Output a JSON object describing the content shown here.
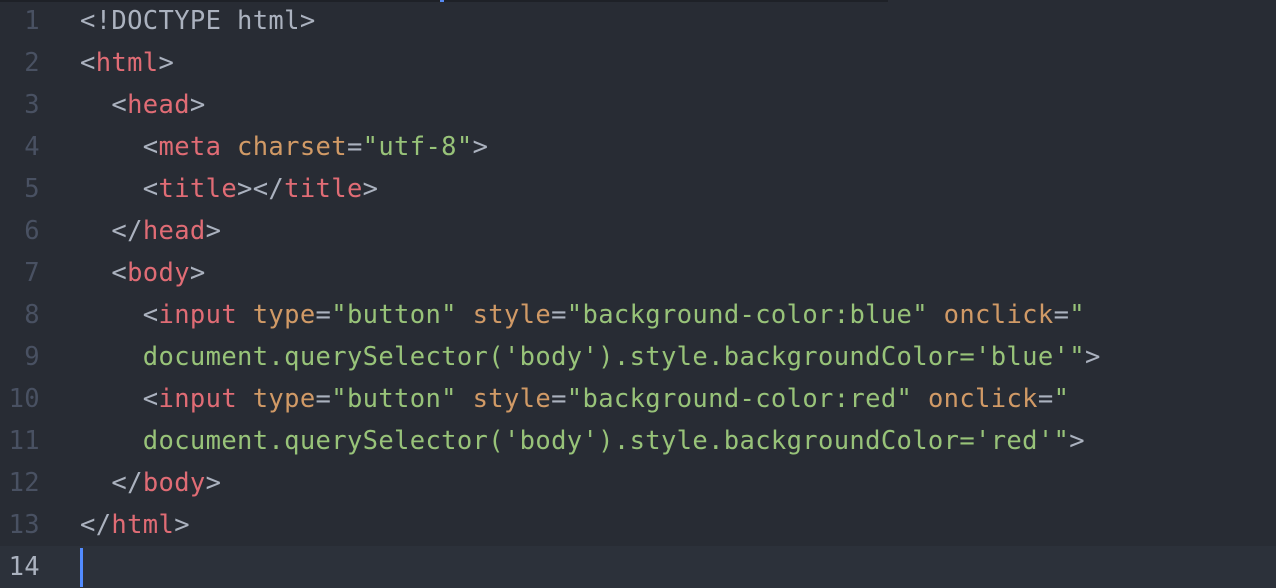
{
  "editor": {
    "lines": [
      {
        "number": "1",
        "tokens": [
          {
            "t": "doctype",
            "v": "<!DOCTYPE html>"
          }
        ]
      },
      {
        "number": "2",
        "tokens": [
          {
            "t": "punct",
            "v": "<"
          },
          {
            "t": "tag",
            "v": "html"
          },
          {
            "t": "punct",
            "v": ">"
          }
        ]
      },
      {
        "number": "3",
        "tokens": [
          {
            "t": "punct",
            "v": "  <"
          },
          {
            "t": "tag",
            "v": "head"
          },
          {
            "t": "punct",
            "v": ">"
          }
        ]
      },
      {
        "number": "4",
        "tokens": [
          {
            "t": "punct",
            "v": "    <"
          },
          {
            "t": "tag",
            "v": "meta"
          },
          {
            "t": "punct",
            "v": " "
          },
          {
            "t": "attr",
            "v": "charset"
          },
          {
            "t": "punct",
            "v": "="
          },
          {
            "t": "str",
            "v": "\"utf-8\""
          },
          {
            "t": "punct",
            "v": ">"
          }
        ]
      },
      {
        "number": "5",
        "tokens": [
          {
            "t": "punct",
            "v": "    <"
          },
          {
            "t": "tag",
            "v": "title"
          },
          {
            "t": "punct",
            "v": "></"
          },
          {
            "t": "tag",
            "v": "title"
          },
          {
            "t": "punct",
            "v": ">"
          }
        ]
      },
      {
        "number": "6",
        "tokens": [
          {
            "t": "punct",
            "v": "  </"
          },
          {
            "t": "tag",
            "v": "head"
          },
          {
            "t": "punct",
            "v": ">"
          }
        ]
      },
      {
        "number": "7",
        "tokens": [
          {
            "t": "punct",
            "v": "  <"
          },
          {
            "t": "tag",
            "v": "body"
          },
          {
            "t": "punct",
            "v": ">"
          }
        ]
      },
      {
        "number": "8",
        "tokens": [
          {
            "t": "punct",
            "v": "    <"
          },
          {
            "t": "tag",
            "v": "input"
          },
          {
            "t": "punct",
            "v": " "
          },
          {
            "t": "attr",
            "v": "type"
          },
          {
            "t": "punct",
            "v": "="
          },
          {
            "t": "str",
            "v": "\"button\""
          },
          {
            "t": "punct",
            "v": " "
          },
          {
            "t": "attr",
            "v": "style"
          },
          {
            "t": "punct",
            "v": "="
          },
          {
            "t": "str",
            "v": "\"background-color:blue\""
          },
          {
            "t": "punct",
            "v": " "
          },
          {
            "t": "attr",
            "v": "onclick"
          },
          {
            "t": "punct",
            "v": "="
          },
          {
            "t": "str",
            "v": "\""
          }
        ]
      },
      {
        "number": "9",
        "tokens": [
          {
            "t": "str",
            "v": "    document.querySelector('body').style.backgroundColor='blue'\""
          },
          {
            "t": "punct",
            "v": ">"
          }
        ]
      },
      {
        "number": "10",
        "tokens": [
          {
            "t": "punct",
            "v": "    <"
          },
          {
            "t": "tag",
            "v": "input"
          },
          {
            "t": "punct",
            "v": " "
          },
          {
            "t": "attr",
            "v": "type"
          },
          {
            "t": "punct",
            "v": "="
          },
          {
            "t": "str",
            "v": "\"button\""
          },
          {
            "t": "punct",
            "v": " "
          },
          {
            "t": "attr",
            "v": "style"
          },
          {
            "t": "punct",
            "v": "="
          },
          {
            "t": "str",
            "v": "\"background-color:red\""
          },
          {
            "t": "punct",
            "v": " "
          },
          {
            "t": "attr",
            "v": "onclick"
          },
          {
            "t": "punct",
            "v": "="
          },
          {
            "t": "str",
            "v": "\""
          }
        ]
      },
      {
        "number": "11",
        "tokens": [
          {
            "t": "str",
            "v": "    document.querySelector('body').style.backgroundColor='red'\""
          },
          {
            "t": "punct",
            "v": ">"
          }
        ]
      },
      {
        "number": "12",
        "tokens": [
          {
            "t": "punct",
            "v": "  </"
          },
          {
            "t": "tag",
            "v": "body"
          },
          {
            "t": "punct",
            "v": ">"
          }
        ]
      },
      {
        "number": "13",
        "tokens": [
          {
            "t": "punct",
            "v": "</"
          },
          {
            "t": "tag",
            "v": "html"
          },
          {
            "t": "punct",
            "v": ">"
          }
        ]
      },
      {
        "number": "14",
        "tokens": [],
        "current": true
      }
    ]
  },
  "theme": {
    "background": "#282c34",
    "current_line": "#2c313a",
    "gutter_text": "#495162",
    "punctuation": "#abb2bf",
    "tag": "#e06c75",
    "attribute": "#d19a66",
    "string": "#98c379",
    "cursor": "#528bff"
  }
}
